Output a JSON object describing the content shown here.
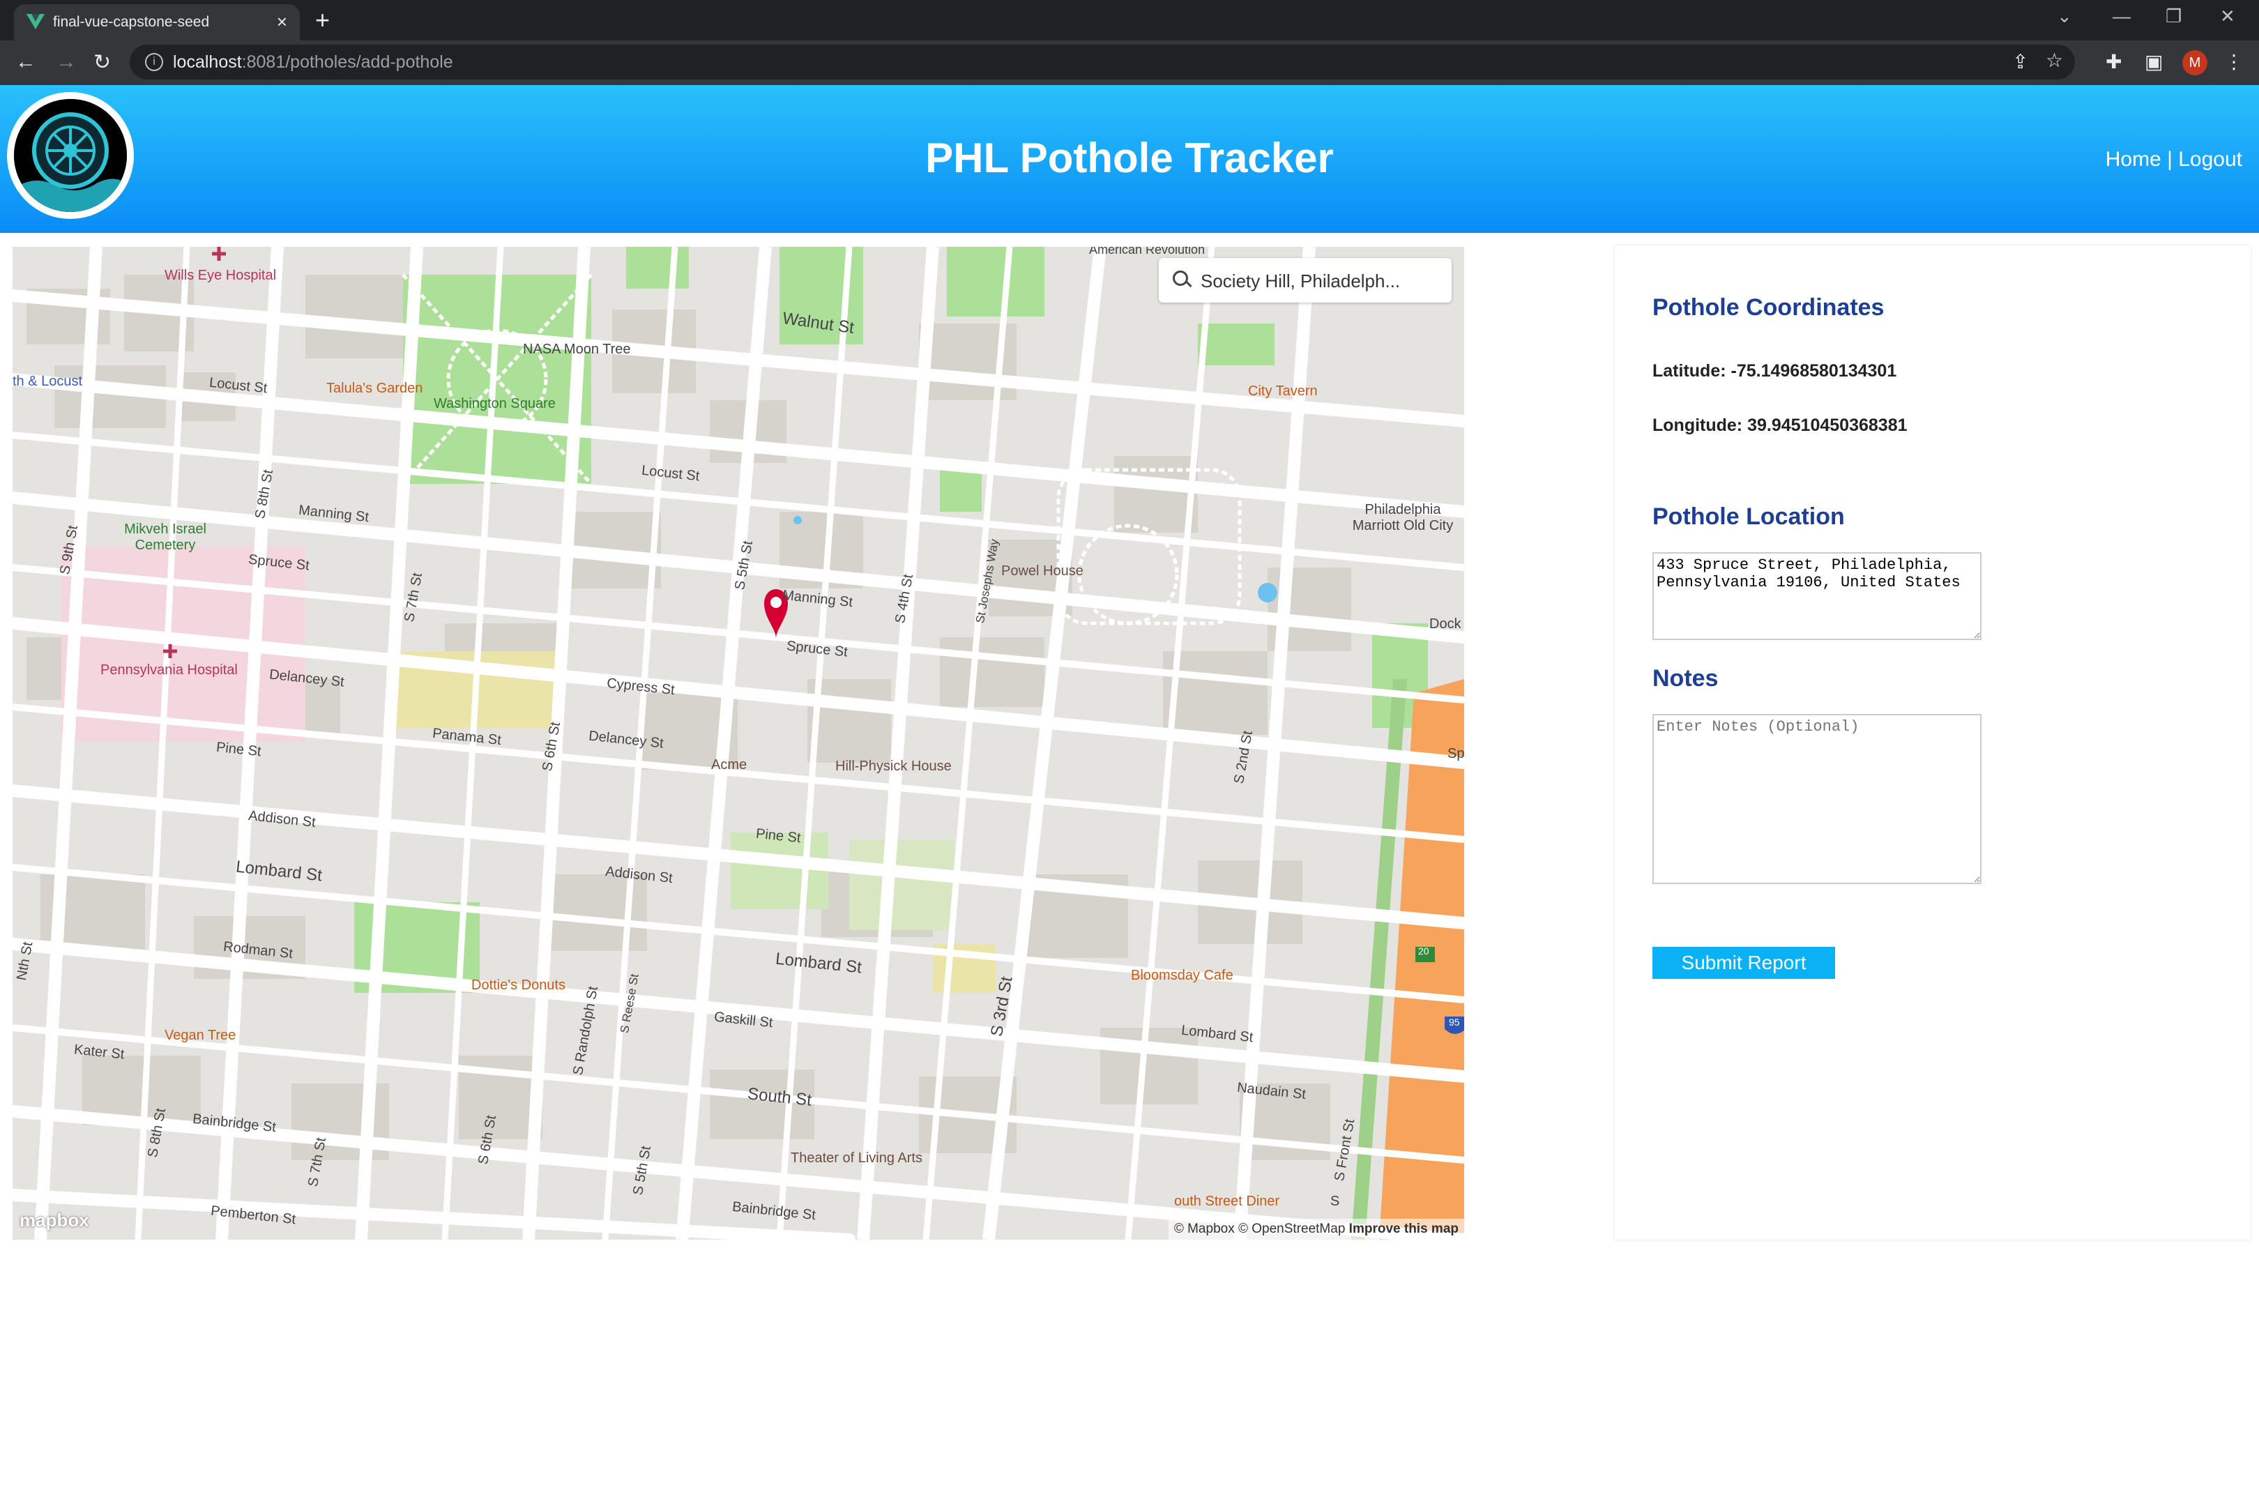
{
  "browser": {
    "tab_title": "final-vue-capstone-seed",
    "url_host": "localhost",
    "url_rest": ":8081/potholes/add-pothole",
    "profile_initial": "M"
  },
  "header": {
    "title": "PHL Pothole Tracker",
    "nav_home": "Home",
    "nav_separator": "|",
    "nav_logout": "Logout"
  },
  "map": {
    "search_value": "Society Hill, Philadelph...",
    "attribution": "© Mapbox © OpenStreetMap",
    "improve_link": "Improve this map",
    "logo_text": "mapbox",
    "labels": {
      "wills_eye": "Wills Eye Hospital",
      "walnut": "Walnut St",
      "nasa_tree": "NASA Moon Tree",
      "washington_sq": "Washington Square",
      "talulas": "Talula's Garden",
      "locust_w": "Locust St",
      "locust_e": "Locust St",
      "th_locust": "th & Locust",
      "city_tavern": "City Tavern",
      "manning_w": "Manning St",
      "manning_e": "Manning St",
      "mikveh": "Mikveh Israel Cemetery",
      "spruce_w": "Spruce St",
      "spruce_e": "Spruce St",
      "powel": "Powel House",
      "marriott": "Philadelphia Marriott Old City",
      "dock": "Dock",
      "penn_hosp": "Pennsylvania Hospital",
      "delancey_w": "Delancey St",
      "delancey_e": "Delancey St",
      "cypress": "Cypress St",
      "panama": "Panama St",
      "acme": "Acme",
      "hill_physick": "Hill-Physick House",
      "pine_w": "Pine St",
      "pine_e": "Pine St",
      "addison_w": "Addison St",
      "addison_e": "Addison St",
      "lombard_w": "Lombard St",
      "lombard_c": "Lombard St",
      "lombard_e": "Lombard St",
      "rodman": "Rodman St",
      "dotties": "Dottie's Donuts",
      "bloomsday": "Bloomsday Cafe",
      "vegan_tree": "Vegan Tree",
      "gaskill": "Gaskill St",
      "kater": "Kater St",
      "south_st": "South St",
      "naudain": "Naudain St",
      "bainbridge_w": "Bainbridge St",
      "bainbridge_e": "Bainbridge St",
      "theater": "Theater of Living Arts",
      "south_diner": "outh Street Diner",
      "pemberton": "Pemberton St",
      "s9th": "S 9th St",
      "s8th_a": "S 8th St",
      "s8th_b": "S 8th St",
      "s7th_a": "S 7th St",
      "s7th_b": "S 7th St",
      "s6th_a": "S 6th St",
      "s6th_b": "S 6th St",
      "s5th_a": "S 5th St",
      "s5th_b": "S 5th St",
      "s4th": "S 4th St",
      "s3rd": "S 3rd St",
      "s2nd": "S 2nd St",
      "sfront": "S Front St",
      "sjoseph": "St Josephs Way",
      "srandolph": "S Randolph St",
      "sreese": "S Reese St",
      "american_rev": "American Revolution",
      "sp": "Sp",
      "s_partial": "S",
      "nth_partial": "Nth St",
      "road_20": "20",
      "road_95": "95"
    }
  },
  "form": {
    "coords_title": "Pothole Coordinates",
    "latitude_label": "Latitude:",
    "latitude_value": "-75.14968580134301",
    "longitude_label": "Longitude:",
    "longitude_value": "39.94510450368381",
    "location_title": "Pothole Location",
    "location_value": "433 Spruce Street, Philadelphia, Pennsylvania 19106, United States",
    "notes_title": "Notes",
    "notes_placeholder": "Enter Notes (Optional)",
    "notes_value": "",
    "submit_label": "Submit Report"
  },
  "colors": {
    "header_top": "#29c0fb",
    "header_bottom": "#0a8cf7",
    "section_title": "#1c3f94",
    "submit_button": "#0ab2f5",
    "map_marker": "#d50032"
  }
}
